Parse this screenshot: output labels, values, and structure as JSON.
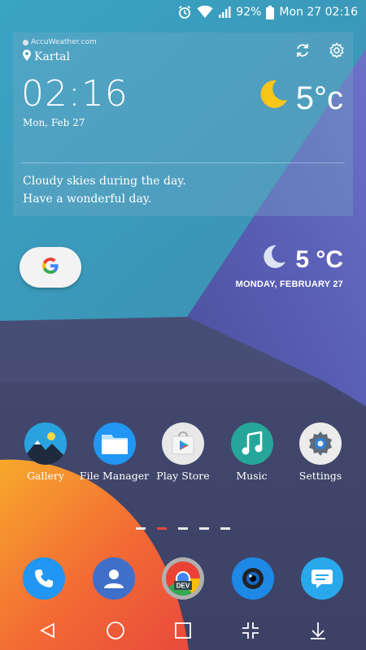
{
  "status_bar": {
    "battery": "92%",
    "date_time": "Mon 27 02:16",
    "icons": [
      "alarm-icon",
      "wifi-icon",
      "signal-icon",
      "battery-icon"
    ]
  },
  "weather_widget": {
    "brand": "AccuWeather.com",
    "location": "Kartal",
    "time": "02:16",
    "date": "Mon, Feb 27",
    "temperature": "5°c",
    "forecast_line1": "Cloudy skies during the day.",
    "forecast_line2": "Have a wonderful day.",
    "icons": [
      "refresh-icon",
      "settings-gear-icon",
      "moon-icon",
      "location-pin-icon"
    ]
  },
  "google_search": {
    "icon": "google-g-icon"
  },
  "weather_widget_2": {
    "temperature": "5 °C",
    "date": "MONDAY, FEBRUARY 27"
  },
  "apps": [
    {
      "label": "Gallery",
      "color": "#2aa2e0"
    },
    {
      "label": "File Manager",
      "color": "#2196f3"
    },
    {
      "label": "Play Store",
      "color": "#e8e8e8"
    },
    {
      "label": "Music",
      "color": "#26a69a"
    },
    {
      "label": "Settings",
      "color": "#ececec"
    }
  ],
  "page_indicator": {
    "pages": 5,
    "active": 2,
    "active_color": "#e9473a"
  },
  "dock": [
    {
      "name": "phone",
      "color": "#2196f3"
    },
    {
      "name": "contacts",
      "color": "#3f6fc9"
    },
    {
      "name": "chrome-dev",
      "color": "#9e9e9e"
    },
    {
      "name": "camera",
      "color": "#1e88e5"
    },
    {
      "name": "messages",
      "color": "#29a8ec"
    }
  ],
  "nav": [
    "back",
    "home",
    "recents",
    "split",
    "notifications-down"
  ]
}
